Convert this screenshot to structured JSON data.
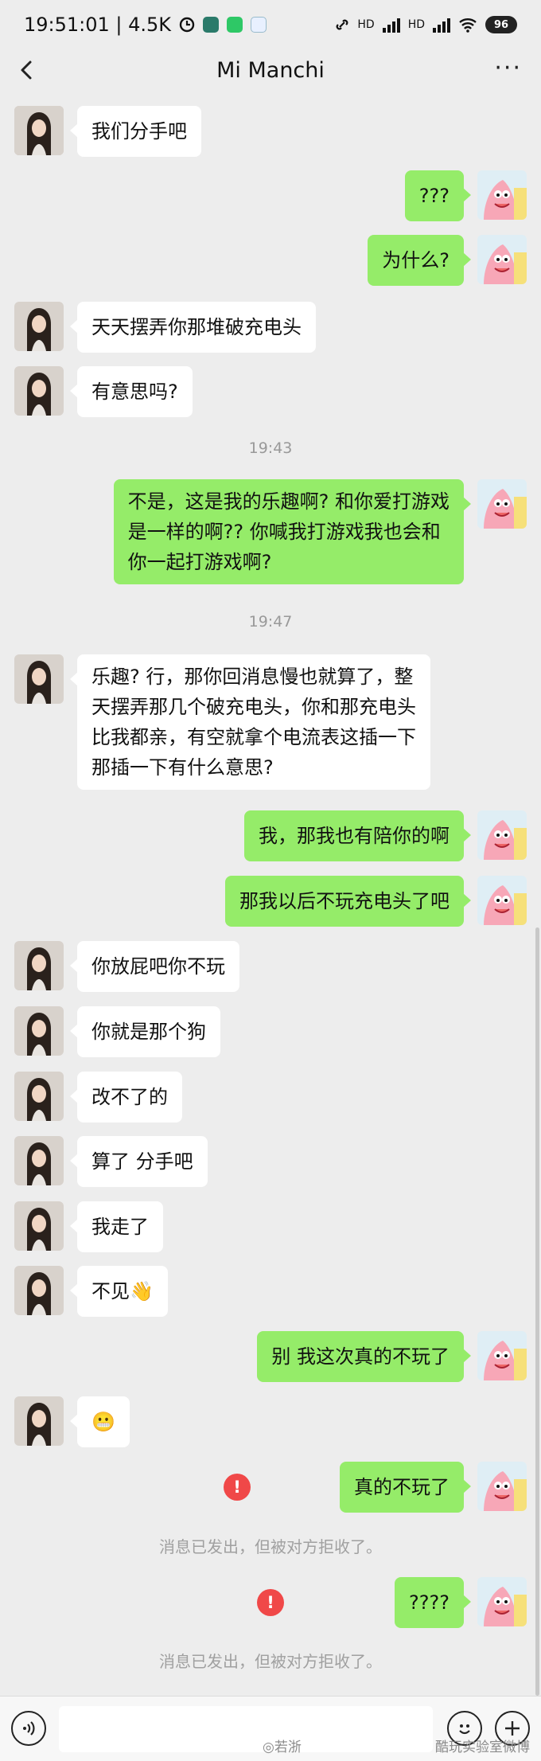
{
  "status_bar": {
    "time_speed": "19:51:01 | 4.5K",
    "net1": "HD",
    "net2": "HD",
    "battery": "96"
  },
  "nav": {
    "title": "Mi Manchi",
    "more_label": "···"
  },
  "messages": {
    "m1": "我们分手吧",
    "m2": "???",
    "m3": "为什么?",
    "m4": "天天摆弄你那堆破充电头",
    "m5": "有意思吗?",
    "ts1": "19:43",
    "m6": [
      "不是，这是我的乐趣啊? 和你爱打游戏",
      "是一样的啊?? 你喊我打游戏我也会和",
      "你一起打游戏啊?"
    ],
    "ts2": "19:47",
    "m7": [
      "乐趣? 行，那你回消息慢也就算了，整",
      "天摆弄那几个破充电头，你和那充电头",
      "比我都亲，有空就拿个电流表这插一下",
      "那插一下有什么意思?"
    ],
    "m8": "我，那我也有陪你的啊",
    "m9": "那我以后不玩充电头了吧",
    "m10": "你放屁吧你不玩",
    "m11": "你就是那个狗",
    "m12": "改不了的",
    "m13": "算了 分手吧",
    "m14": "我走了",
    "m15": "不见👋",
    "m16": "别 我这次真的不玩了",
    "m17": "😬",
    "m18": "真的不玩了",
    "sys1": "消息已发出，但被对方拒收了。",
    "m19": "????",
    "sys2": "消息已发出，但被对方拒收了。"
  },
  "error_glyph": "!",
  "input_bar": {
    "input_value": "",
    "watermark": "◎若浙",
    "watermark_right": "酷玩实验室微博"
  },
  "colors": {
    "my_bubble": "#95ec69",
    "her_bubble": "#ffffff",
    "background": "#ededed",
    "error": "#f04848"
  },
  "icons": {
    "back": "chevron-left-icon",
    "more": "more-dots-icon",
    "voice": "voice-icon",
    "emoji": "emoji-icon",
    "plus": "plus-icon",
    "error": "error-exclamation-icon"
  }
}
